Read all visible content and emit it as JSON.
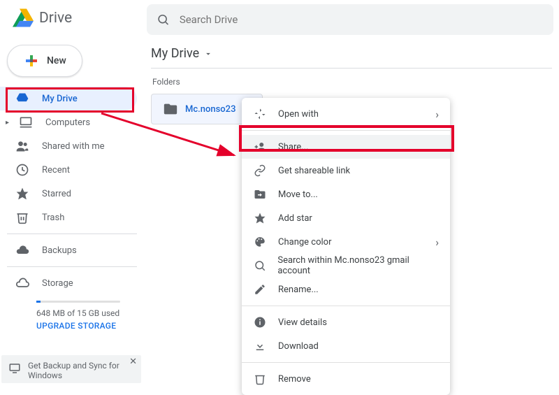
{
  "brand": "Drive",
  "search_placeholder": "Search Drive",
  "new_button": "New",
  "nav": {
    "my_drive": "My Drive",
    "computers": "Computers",
    "shared": "Shared with me",
    "recent": "Recent",
    "starred": "Starred",
    "trash": "Trash",
    "backups": "Backups",
    "storage": "Storage"
  },
  "storage_text": "648 MB of 15 GB used",
  "upgrade_text": "UPGRADE STORAGE",
  "breadcrumb": "My Drive",
  "folders_label": "Folders",
  "folder_name": "Mc.nonso23",
  "menu": {
    "open_with": "Open with",
    "share": "Share...",
    "get_link": "Get shareable link",
    "move_to": "Move to...",
    "add_star": "Add star",
    "change_color": "Change color",
    "search_within": "Search within Mc.nonso23 gmail account",
    "rename": "Rename...",
    "view_details": "View details",
    "download": "Download",
    "remove": "Remove"
  },
  "snackbar": "Get Backup and Sync for Windows",
  "annotations": {
    "highlight_my_drive": true,
    "highlight_share": true,
    "arrow_from_my_drive_to_share": true
  }
}
